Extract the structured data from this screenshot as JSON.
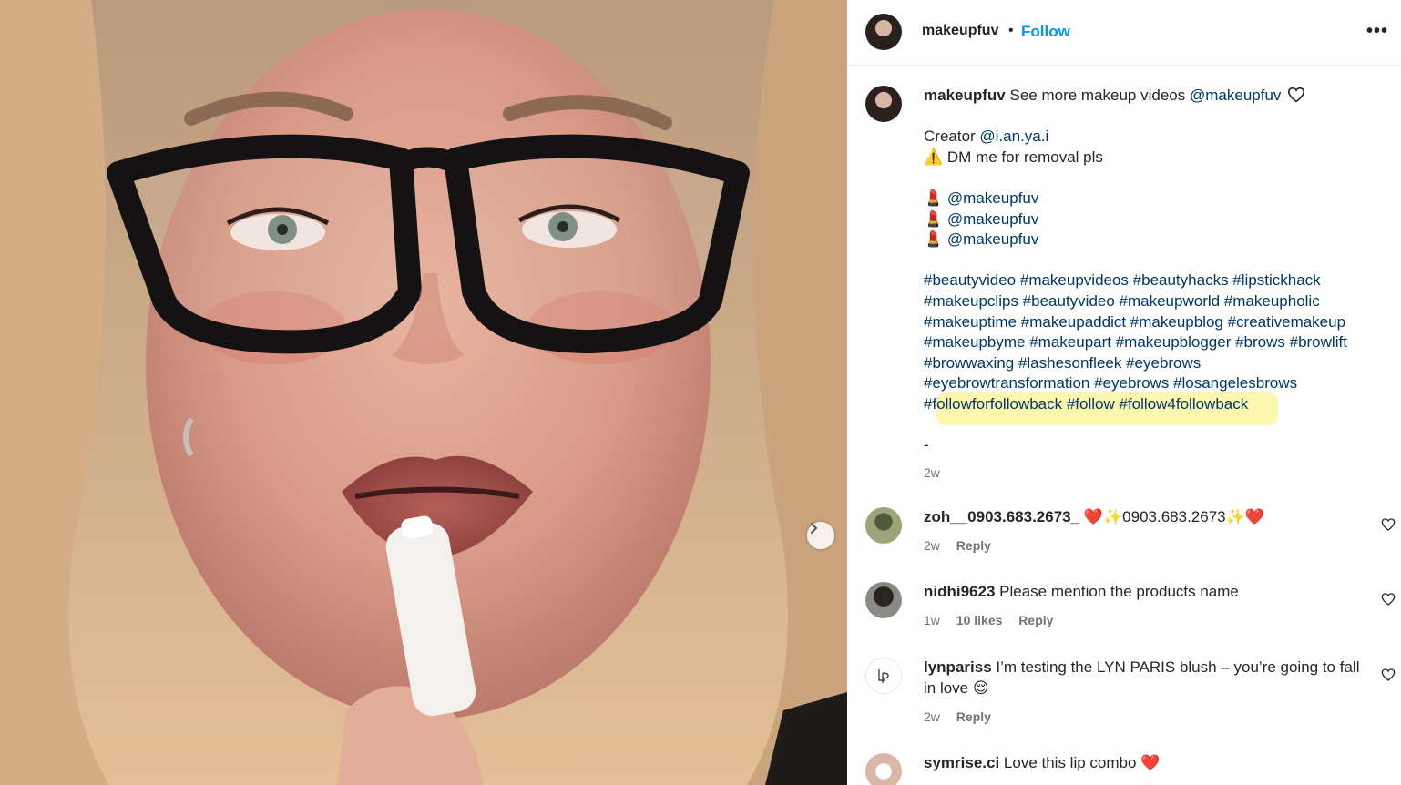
{
  "post": {
    "username": "makeupfuv",
    "separator": "•",
    "follow_label": "Follow",
    "more_label": "•••"
  },
  "caption": {
    "username": "makeupfuv",
    "intro": "See more makeup videos",
    "intro_mention": "@makeupfuv",
    "creator_label": "Creator",
    "creator_mention": "@i.an.ya.i",
    "warning_emoji": "⚠️",
    "warning_text": "DM me for removal pls",
    "lipstick_emoji": "💄",
    "mentions": [
      "@makeupfuv",
      "@makeupfuv",
      "@makeupfuv"
    ],
    "hashtag_lines": [
      "#beautyvideo #makeupvideos #beautyhacks #lipstickhack",
      "#makeupclips #beautyvideo #makeupworld #makeupholic",
      "#makeuptime #makeupaddict #makeupblog #creativemakeup",
      "#makeupbyme #makeupart #makeupblogger #brows #browlift",
      "#browwaxing #lashesonfleek #eyebrows",
      "#eyebrowtransformation #eyebrows #losangelesbrows",
      "#followforfollowback #follow #follow4followback"
    ],
    "dash": "-",
    "time": "2w"
  },
  "comments": [
    {
      "username": "zoh__0903.683.2673_",
      "text": "❤️✨0903.683.2673✨❤️",
      "time": "2w",
      "likes": "",
      "reply": "Reply"
    },
    {
      "username": "nidhi9623",
      "text": "Please mention the products name",
      "time": "1w",
      "likes": "10 likes",
      "reply": "Reply"
    },
    {
      "username": "lynpariss",
      "text": "I’m testing the LYN PARIS blush – you’re going to fall in love 😌",
      "time": "2w",
      "likes": "",
      "reply": "Reply"
    },
    {
      "username": "symrise.ci",
      "text": "Love this lip combo ❤️",
      "time": "",
      "likes": "",
      "reply": ""
    }
  ],
  "icons": {
    "next": "chevron-right-icon",
    "heart": "heart-icon",
    "more": "more-icon"
  },
  "colors": {
    "link": "#00376b",
    "follow": "#0095f6",
    "highlight": "#fbf6a0",
    "secondary": "#737373"
  }
}
